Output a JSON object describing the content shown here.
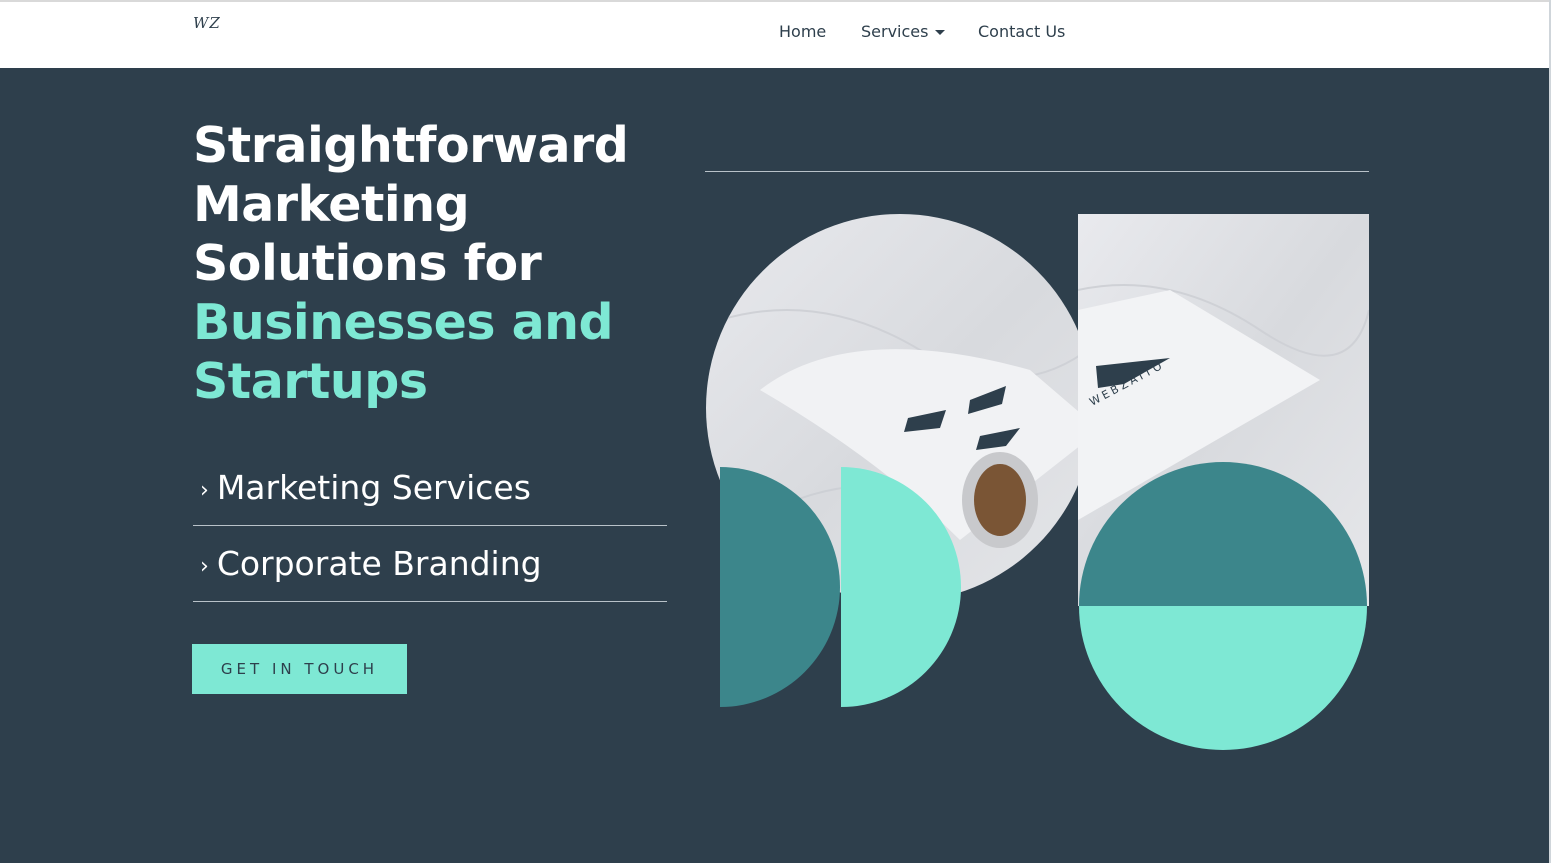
{
  "header": {
    "logo": "WZ",
    "nav": {
      "home": "Home",
      "services": "Services",
      "contact": "Contact Us"
    }
  },
  "hero": {
    "headline_lines": [
      "Straightforward",
      "Marketing",
      "Solutions for"
    ],
    "headline_accent_lines": [
      "Businesses and",
      "Startups"
    ],
    "services": [
      {
        "label": "Marketing Services"
      },
      {
        "label": "Corporate Branding"
      }
    ],
    "cta_label": "GET IN TOUCH",
    "chevron": "›"
  },
  "image": {
    "brand_text": "WEBZAITO"
  },
  "colors": {
    "background": "#2e3f4c",
    "accent": "#7ee8d4",
    "teal_dark": "#3c868b",
    "nav_text": "#2e3f4c"
  }
}
